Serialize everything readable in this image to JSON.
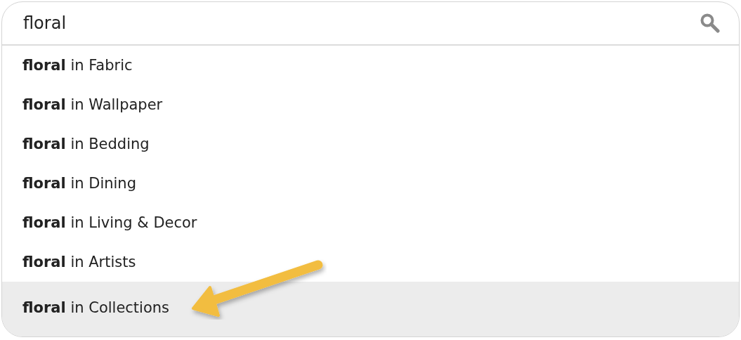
{
  "search": {
    "value": "floral"
  },
  "suggestions": [
    {
      "label": "**floral** in Fabric",
      "selected": false
    },
    {
      "label": "**floral** in Wallpaper",
      "selected": false
    },
    {
      "label": "**floral** in Bedding",
      "selected": false
    },
    {
      "label": "**floral** in Dining",
      "selected": false
    },
    {
      "label": "**floral** in Living & Decor",
      "selected": false
    },
    {
      "label": "**floral** in Artists",
      "selected": false
    },
    {
      "label": "**floral** in Collections",
      "selected": true
    }
  ]
}
